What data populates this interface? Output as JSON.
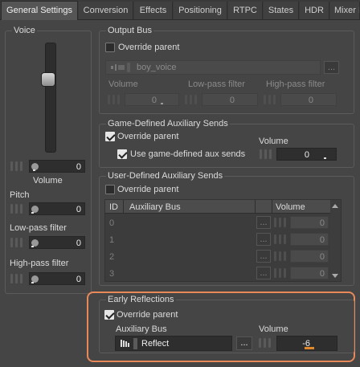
{
  "tabs": [
    {
      "label": "General Settings",
      "active": true
    },
    {
      "label": "Conversion"
    },
    {
      "label": "Effects"
    },
    {
      "label": "Positioning"
    },
    {
      "label": "RTPC"
    },
    {
      "label": "States"
    },
    {
      "label": "HDR"
    },
    {
      "label": "Mixer Plu"
    }
  ],
  "voice": {
    "title": "Voice",
    "volume_value": "0",
    "volume_label": "Volume",
    "pitch_label": "Pitch",
    "pitch_value": "0",
    "lowpass_label": "Low-pass filter",
    "lowpass_value": "0",
    "highpass_label": "High-pass filter",
    "highpass_value": "0"
  },
  "output_bus": {
    "title": "Output Bus",
    "override_label": "Override parent",
    "bus_name": "boy_voice",
    "browse_label": "...",
    "volume_label": "Volume",
    "volume_value": "0",
    "lowpass_label": "Low-pass filter",
    "lowpass_value": "0",
    "highpass_label": "High-pass filter",
    "highpass_value": "0"
  },
  "game_defined": {
    "title": "Game-Defined Auxiliary Sends",
    "override_label": "Override parent",
    "use_label": "Use game-defined aux sends",
    "volume_label": "Volume",
    "volume_value": "0"
  },
  "user_defined": {
    "title": "User-Defined Auxiliary Sends",
    "override_label": "Override parent",
    "col_id": "ID",
    "col_bus": "Auxiliary Bus",
    "col_volume": "Volume",
    "rows": [
      {
        "id": "0",
        "volume": "0",
        "browse": "..."
      },
      {
        "id": "1",
        "volume": "0",
        "browse": "..."
      },
      {
        "id": "2",
        "volume": "0",
        "browse": "..."
      },
      {
        "id": "3",
        "volume": "0",
        "browse": "..."
      }
    ]
  },
  "early_reflections": {
    "title": "Early Reflections",
    "override_label": "Override parent",
    "bus_label": "Auxiliary Bus",
    "bus_name": "Reflect",
    "browse_label": "...",
    "volume_label": "Volume",
    "volume_value": "-6"
  },
  "colors": {
    "highlight": "#e8895a",
    "accent_bar": "#e0882a"
  },
  "icons": [
    "bus-icon",
    "bus-hand-icon",
    "knob-icon",
    "grip-icon",
    "checkmark-icon",
    "scroll-up-icon",
    "scroll-down-icon"
  ]
}
